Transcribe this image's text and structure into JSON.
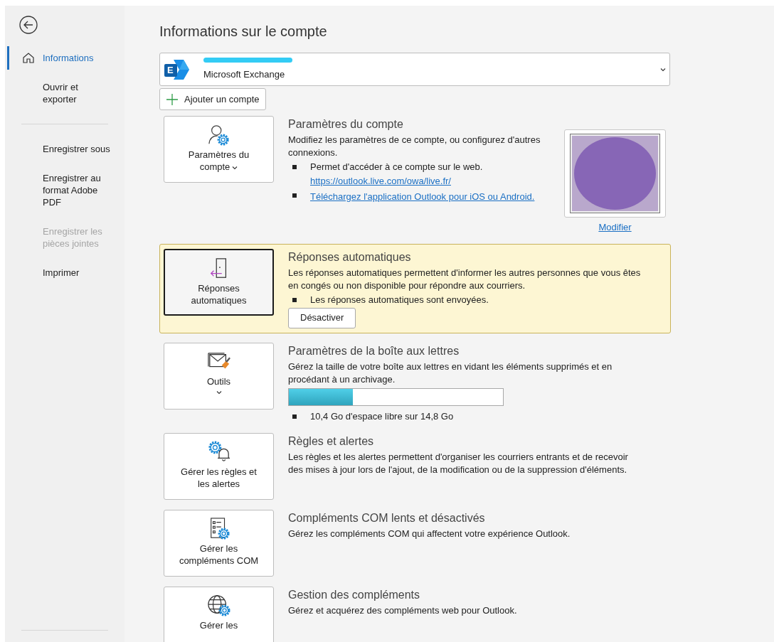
{
  "sidebar": {
    "items": [
      {
        "kind": "home",
        "label": "Informations",
        "selected": true,
        "disabled": false
      },
      {
        "kind": "item",
        "label": "Ouvrir et exporter",
        "selected": false,
        "disabled": false
      },
      {
        "kind": "divider"
      },
      {
        "kind": "item",
        "label": "Enregistrer sous",
        "selected": false,
        "disabled": false
      },
      {
        "kind": "item",
        "label": "Enregistrer au format Adobe PDF",
        "selected": false,
        "disabled": false
      },
      {
        "kind": "item",
        "label": "Enregistrer les pièces jointes",
        "selected": false,
        "disabled": true
      },
      {
        "kind": "item",
        "label": "Imprimer",
        "selected": false,
        "disabled": false
      }
    ]
  },
  "title": "Informations sur le compte",
  "account": {
    "logo_letter": "E",
    "type": "Microsoft Exchange",
    "name_redacted": true
  },
  "add_account_button": "Ajouter un compte",
  "sections": [
    {
      "kind": "account",
      "button_label": "Paramètres du compte",
      "highlighted": false,
      "title": "Paramètres du compte",
      "description": "Modifiez les paramètres de ce compte, ou configurez d'autres connexions.",
      "bullets": [
        {
          "text": "Permet d'accéder à ce compte sur le web.",
          "link": "https://outlook.live.com/owa/live.fr/"
        },
        {
          "link": "Téléchargez l'application Outlook pour iOS ou Android."
        }
      ],
      "photo_link": "Modifier"
    },
    {
      "kind": "auto_reply",
      "button_label": "Réponses automatiques",
      "highlighted": true,
      "title": "Réponses automatiques",
      "description": "Les réponses automatiques permettent d'informer les autres personnes que vous êtes en congés ou non disponible pour répondre aux courriers.",
      "bullets": [
        {
          "text": "Les réponses automatiques sont envoyées."
        }
      ],
      "action_button": "Désactiver"
    },
    {
      "kind": "tools",
      "button_label": "Outils",
      "highlighted": false,
      "title": "Paramètres de la boîte aux lettres",
      "description": "Gérez la taille de votre boîte aux lettres en vidant les éléments supprimés et en procédant à un archivage.",
      "level": 0.3,
      "bullets": [
        {
          "text": "10,4 Go d'espace libre sur 14,8 Go"
        }
      ]
    },
    {
      "kind": "rules",
      "button_label": "Gérer les règles et les alertes",
      "highlighted": false,
      "title": "Règles et alertes",
      "description": "Les règles et les alertes permettent d'organiser les courriers entrants et de recevoir des mises à jour lors de l'ajout, de la modification ou de la suppression d'éléments."
    },
    {
      "kind": "com",
      "button_label": "Gérer les compléments COM",
      "highlighted": false,
      "title": "Compléments COM lents et désactivés",
      "description": "Gérez les compléments COM qui affectent votre expérience Outlook."
    },
    {
      "kind": "addins",
      "button_label": "Gérer les",
      "highlighted": false,
      "title": "Gestion des compléments",
      "description": "Gérez et acquérez des compléments web pour Outlook."
    }
  ]
}
